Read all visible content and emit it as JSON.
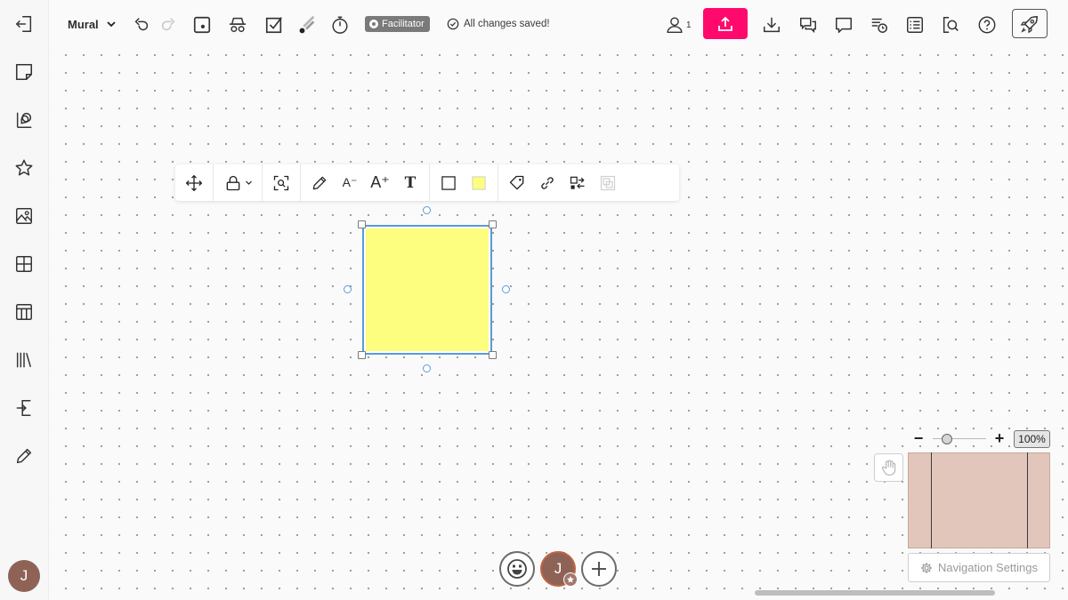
{
  "header": {
    "board_title": "Mural",
    "facilitator_badge": "Facilitator",
    "save_status": "All changes saved!",
    "collaborator_count": "1"
  },
  "toolbar": {
    "icons": [
      "undo-icon",
      "redo-icon",
      "timer-icon",
      "privacy-mode-icon",
      "voting-icon",
      "laser-pointer-icon",
      "stopwatch-icon"
    ],
    "right_icons": [
      "share-icon",
      "download-icon",
      "comments-icon",
      "chat-icon",
      "activity-icon",
      "outline-icon",
      "search-icon",
      "help-icon",
      "launch-icon"
    ]
  },
  "object_toolbar": {
    "decrease_font_label": "A⁻",
    "increase_font_label": "A⁺",
    "text_format_label": "T",
    "sticky_color": "#fdfd7f"
  },
  "sidebar": {
    "items": [
      "exit-icon",
      "sticky-note-icon",
      "shapes-connectors-icon",
      "favorites-icon",
      "images-icon",
      "frameworks-icon",
      "table-icon",
      "library-icon",
      "import-icon",
      "draw-icon"
    ],
    "user_initial": "J"
  },
  "bottom": {
    "user_initial": "J"
  },
  "navigation": {
    "zoom_level": "100%",
    "zoom_minus": "−",
    "zoom_plus": "+",
    "settings_label": "Navigation Settings"
  },
  "colors": {
    "accent": "#ff0a6c",
    "selection": "#5b9ad8",
    "avatar": "#8e6355",
    "minimap": "#e3c6bb"
  }
}
